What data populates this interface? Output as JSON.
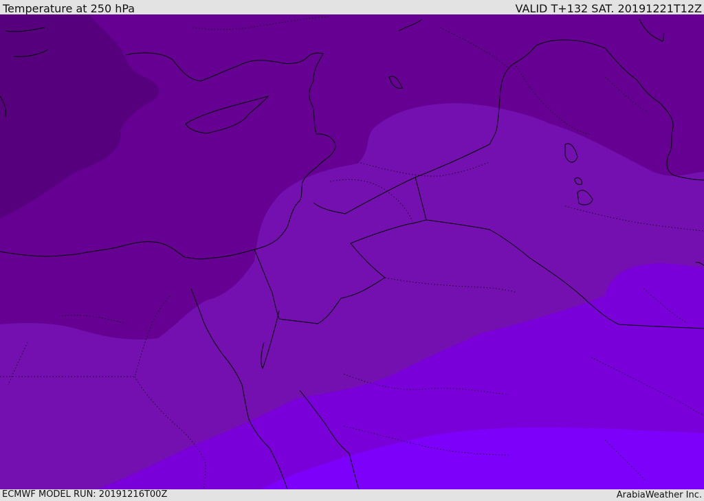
{
  "header": {
    "title": "Temperature at 250 hPa",
    "valid_time": "VALID T+132 SAT. 20191221T12Z"
  },
  "footer": {
    "model_run": "ECMWF MODEL RUN: 20191216T00Z",
    "credit": "ArabiaWeather Inc."
  },
  "map": {
    "field": "temperature",
    "level_hpa": 250,
    "colors": {
      "band_coldest": "#56007e",
      "band_cold": "#660092",
      "band_mid": "#7310af",
      "band_warm": "#7a00d9",
      "band_warmest": "#7d00fb",
      "coastline": "#000000",
      "borders": "#000000"
    }
  }
}
